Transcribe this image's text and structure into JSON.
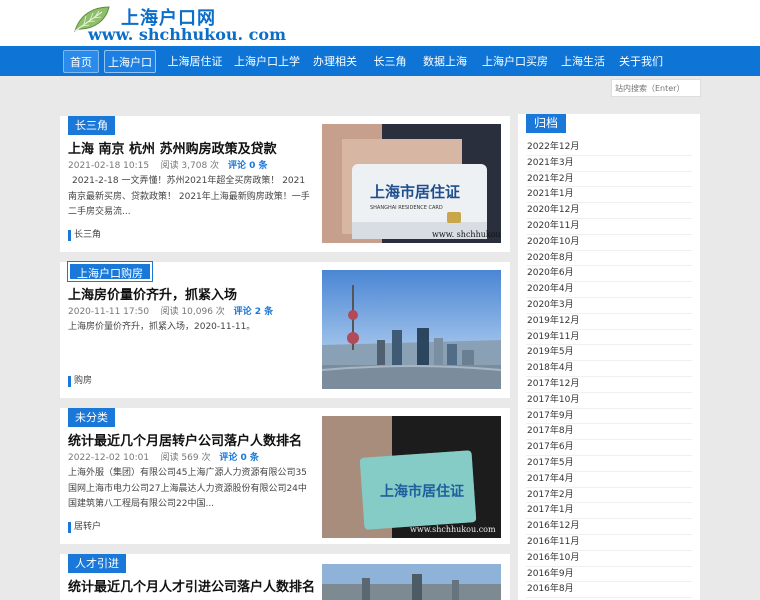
{
  "site": {
    "name": "上海户口网",
    "url": "www. shchhukou. com"
  },
  "nav": [
    "首页",
    "上海户口",
    "上海居住证",
    "上海户口上学",
    "办理相关",
    "长三角",
    "数据上海",
    "上海户口买房",
    "上海生活",
    "关于我们"
  ],
  "search": {
    "placeholder": "站内搜索（Enter）"
  },
  "posts": [
    {
      "tag": "长三角",
      "title": "上海 南京 杭州 苏州购房政策及贷款",
      "date": "2021-02-18 10:15",
      "views": "阅读 3,708 次",
      "comments": "评论 0 条",
      "excerpt": "2021-2-18 一文弄懂！苏州2021年超全买房政策！ 2021南京最新买房、贷款政策！ 2021年上海最新购房政策！一手二手房交易流...",
      "category": "长三角",
      "image": {
        "card_text": "上海市居住证",
        "card_sub": "SHANGHAI RESIDENCE CARD",
        "watermark": "www. shchhukou. com"
      }
    },
    {
      "tag": "上海户口购房",
      "title": "上海房价量价齐升，抓紧入场",
      "date": "2020-11-11 17:50",
      "views": "阅读 10,096 次",
      "comments": "评论 2 条",
      "excerpt": "上海房价量价齐升，抓紧入场，2020-11-11。",
      "category": "购房"
    },
    {
      "tag": "未分类",
      "title": "统计最近几个月居转户公司落户人数排名",
      "date": "2022-12-02 10:01",
      "views": "阅读 569 次",
      "comments": "评论 0 条",
      "excerpt": "上海外服（集团）有限公司45上海广源人力资源有限公司35国网上海市电力公司27上海晨达人力资源股份有限公司24中国建筑第八工程局有限公司22中国...",
      "category": "居转户",
      "image": {
        "card_text": "上海市居住证",
        "watermark": "www.shchhukou.com"
      }
    },
    {
      "tag": "人才引进",
      "title": "统计最近几个月人才引进公司落户人数排名"
    }
  ],
  "sidebar": {
    "title": "归档",
    "archives": [
      "2022年12月",
      "2021年3月",
      "2021年2月",
      "2021年1月",
      "2020年12月",
      "2020年11月",
      "2020年10月",
      "2020年8月",
      "2020年6月",
      "2020年4月",
      "2020年3月",
      "2019年12月",
      "2019年11月",
      "2019年5月",
      "2018年4月",
      "2017年12月",
      "2017年10月",
      "2017年9月",
      "2017年8月",
      "2017年6月",
      "2017年5月",
      "2017年4月",
      "2017年2月",
      "2017年1月",
      "2016年12月",
      "2016年11月",
      "2016年10月",
      "2016年9月",
      "2016年8月"
    ]
  }
}
